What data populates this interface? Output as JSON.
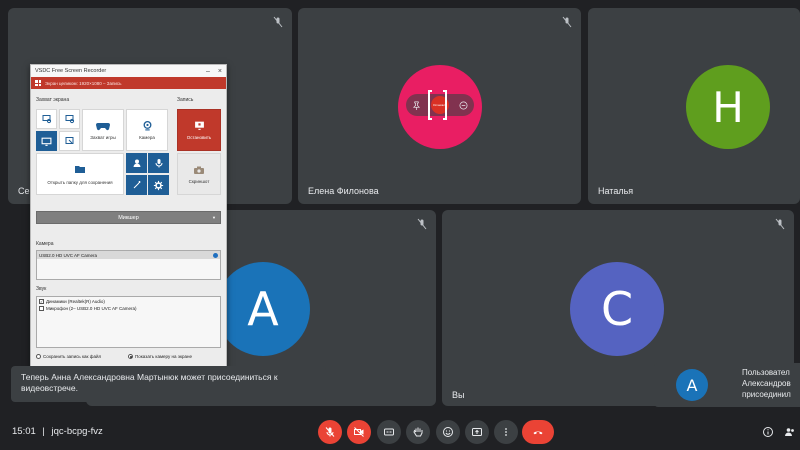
{
  "tiles": {
    "tile1": {
      "name_fragment": "Се"
    },
    "tile2": {
      "name": "Елена Филонова",
      "overlay_label": "Остановить"
    },
    "tile3": {
      "name": "Наталья",
      "avatar_letter": "Н"
    },
    "tile4": {
      "avatar_letter": "А"
    },
    "tile5": {
      "name": "Вы",
      "avatar_letter": "С"
    }
  },
  "recorder": {
    "title": "VSDC Free Screen Recorder",
    "status": "Экран целиком: 1920×1080 – Запись",
    "section_capture": "Захват экрана",
    "section_record": "Запись",
    "btn_game": "Захват игры",
    "btn_camera": "Камера",
    "btn_stop": "Остановить",
    "btn_open_folder": "Открыть папку для сохранения",
    "btn_screenshot": "Скриншот",
    "mixer": "Микшер",
    "camera_label": "Камера",
    "camera_device": "USB2.0 HD UVC AF Camera",
    "sound_label": "Звук",
    "sound_items": [
      {
        "label": "Динамики (Realtek(R) Audio)",
        "checked": true
      },
      {
        "label": "Микрофон (2– USB2.0 HD UVC AF Camera)",
        "checked": false
      }
    ],
    "radio_save": "Сохранить запись как файл",
    "radio_show_camera": "Показать камеру на экране"
  },
  "toast": {
    "line1": "Теперь Анна Александровна Мартынюк может присоединиться к",
    "line2": "видеовстрече."
  },
  "notification": {
    "avatar_letter": "А",
    "line1": "Пользовател",
    "line2": "Александров",
    "line3": "присоединил"
  },
  "bottom_bar": {
    "time": "15:01",
    "separator": "|",
    "meeting_code": "jqc-bcpg-fvz"
  },
  "colors": {
    "background": "#202124",
    "tile": "#3c4043",
    "avatar_pink": "#e91e63",
    "avatar_green": "#5f9e1e",
    "avatar_blue": "#1a73b8",
    "avatar_indigo": "#5563c1",
    "danger": "#ea4335"
  }
}
